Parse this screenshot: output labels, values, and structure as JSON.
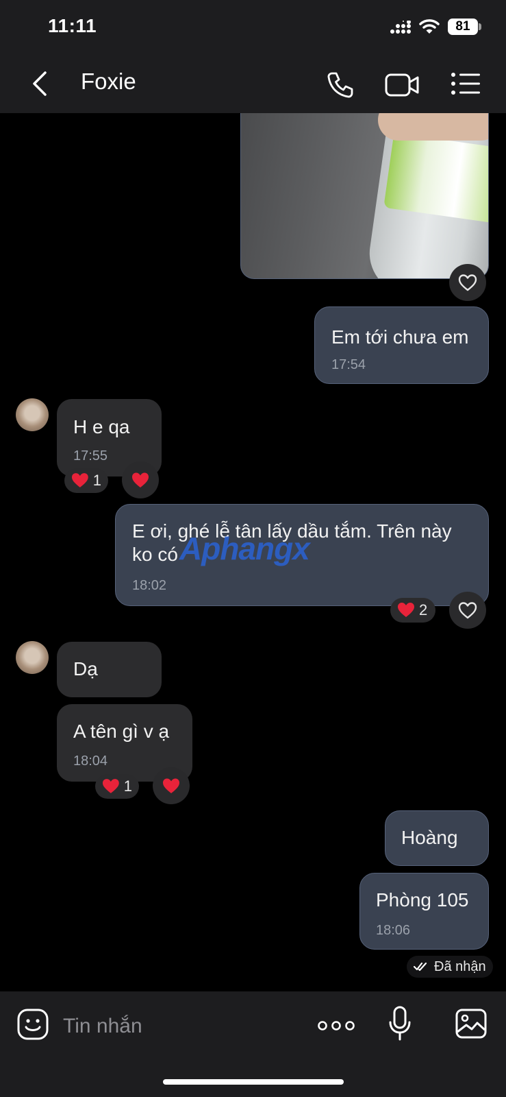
{
  "status_bar": {
    "time": "11:11",
    "battery": "81"
  },
  "header": {
    "contact_name": "Foxie"
  },
  "messages": [
    {
      "text": "Em tới chưa em",
      "time": "17:54"
    },
    {
      "text": "H e qa",
      "time": "17:55",
      "reaction_count": "1"
    },
    {
      "text": "E ơi, ghé lễ tân lấy dầu tắm. Trên này ko có",
      "time": "18:02",
      "reaction_count": "2"
    },
    {
      "text": "Dạ"
    },
    {
      "text": "A tên gì v ạ",
      "time": "18:04",
      "reaction_count": "1"
    },
    {
      "text": "Hoàng"
    },
    {
      "text": "Phòng 105",
      "time": "18:06"
    }
  ],
  "delivery_status": "Đã nhận",
  "watermark": "Aphangx",
  "composer": {
    "placeholder": "Tin nhắn"
  },
  "colors": {
    "outgoing_bubble": "#3a4251",
    "incoming_bubble": "#2c2c2e",
    "background": "#000000",
    "header": "#1d1d1f",
    "reaction_heart": "#e8233a"
  }
}
